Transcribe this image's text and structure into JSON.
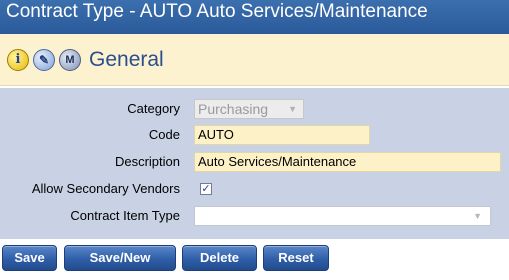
{
  "window": {
    "title": "Contract Type - AUTO Auto Services/Maintenance"
  },
  "header": {
    "icons": [
      "info-icon",
      "notes-icon",
      "memo-icon"
    ],
    "title": "General",
    "colors": {
      "title_bar": "#2f609f",
      "header_bg": "#fdf2d0",
      "form_bg": "#c9d2e4",
      "field_bg": "#fdf2c7"
    }
  },
  "form": {
    "category": {
      "label": "Category",
      "value": "Purchasing"
    },
    "code": {
      "label": "Code",
      "value": "AUTO"
    },
    "description": {
      "label": "Description",
      "value": "Auto Services/Maintenance"
    },
    "allow_secondary": {
      "label": "Allow Secondary Vendors",
      "checked": true
    },
    "contract_item_type": {
      "label": "Contract Item Type",
      "value": ""
    }
  },
  "actions": {
    "save": "Save",
    "save_new": "Save/New",
    "delete": "Delete",
    "reset": "Reset"
  }
}
